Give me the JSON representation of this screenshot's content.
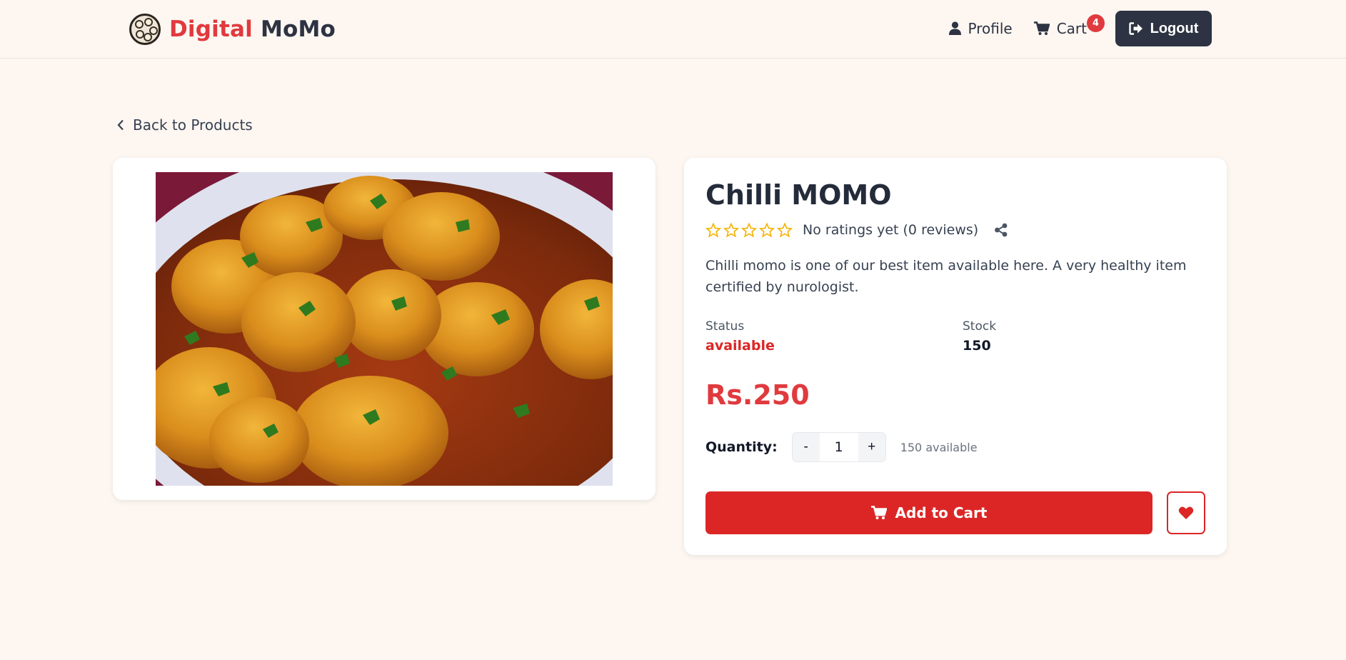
{
  "navbar": {
    "logo_part1": "Digital",
    "logo_part2": "MoMo",
    "profile_label": "Profile",
    "cart_label": "Cart",
    "cart_count": "4",
    "logout_label": "Logout"
  },
  "back_link": "Back to Products",
  "product": {
    "name": "Chilli MOMO",
    "rating_text": "No ratings yet (0 reviews)",
    "stars_filled": 0,
    "stars_total": 5,
    "description": "Chilli momo is one of our best item available here. A very healthy item certified by nurologist.",
    "status_label": "Status",
    "status_value": "available",
    "stock_label": "Stock",
    "stock_value": "150",
    "price": "Rs.250"
  },
  "quantity": {
    "label": "Quantity:",
    "minus": "-",
    "value": "1",
    "plus": "+",
    "available_text": "150 available"
  },
  "actions": {
    "add_to_cart": "Add to Cart"
  },
  "colors": {
    "accent": "#e03a3e",
    "dark": "#2d3342",
    "button_red": "#dc2626",
    "star": "#f5b301",
    "background": "#fdf6f1"
  }
}
